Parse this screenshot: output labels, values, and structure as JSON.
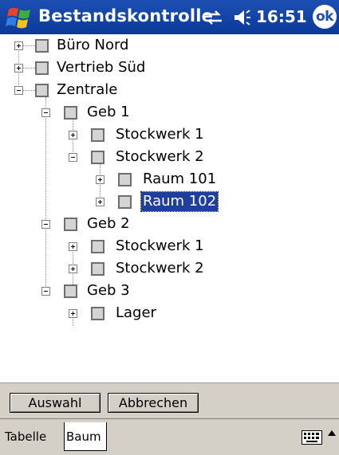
{
  "titlebar": {
    "title": "Bestandskontrolle",
    "time": "16:51",
    "ok_label": "ok",
    "color": "#0a3a99"
  },
  "tree": {
    "nodes": [
      {
        "label": "Büro Nord",
        "level": 0,
        "expander": "plus"
      },
      {
        "label": "Vertrieb Süd",
        "level": 0,
        "expander": "plus"
      },
      {
        "label": "Zentrale",
        "level": 0,
        "expander": "minus"
      },
      {
        "label": "Geb 1",
        "level": 1,
        "expander": "minus"
      },
      {
        "label": "Stockwerk 1",
        "level": 2,
        "expander": "plus"
      },
      {
        "label": "Stockwerk 2",
        "level": 2,
        "expander": "minus"
      },
      {
        "label": "Raum 101",
        "level": 3,
        "expander": "plus"
      },
      {
        "label": "Raum 102",
        "level": 3,
        "expander": "plus",
        "selected": true
      },
      {
        "label": "Geb 2",
        "level": 1,
        "expander": "minus"
      },
      {
        "label": "Stockwerk 1",
        "level": 2,
        "expander": "plus"
      },
      {
        "label": "Stockwerk 2",
        "level": 2,
        "expander": "plus"
      },
      {
        "label": "Geb 3",
        "level": 1,
        "expander": "minus"
      },
      {
        "label": "Lager",
        "level": 2,
        "expander": "plus"
      }
    ],
    "selection_color": "#1e3f9c"
  },
  "buttons": {
    "select_label": "Auswahl",
    "cancel_label": "Abbrechen"
  },
  "tabs": {
    "table_label": "Tabelle",
    "tree_label": "Baum",
    "active": "Baum"
  }
}
